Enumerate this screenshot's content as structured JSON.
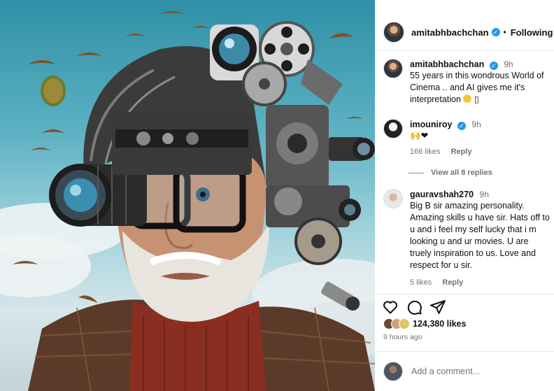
{
  "post": {
    "author": "amitabhbachchan",
    "follow_label": "Following",
    "separator": "•"
  },
  "caption": {
    "author": "amitabhbachchan",
    "time": "9h",
    "text": "55 years in this wondrous World of Cinema .. and AI gives me it's interpretation"
  },
  "comments": [
    {
      "author": "imouniroy",
      "time": "9h",
      "text": "🙌❤",
      "likes": "166 likes",
      "reply_label": "Reply"
    },
    {
      "author": "gauravshah270",
      "time": "9h",
      "text": "Big B sir amazing personality. Amazing skills u have sir. Hats off to u and i feel my self lucky that i m looking u and ur movies. U are truely inspiration to us. Love and respect for u sir.",
      "likes": "5 likes",
      "reply_label": "Reply"
    }
  ],
  "view_replies": "View all 8 replies",
  "likes_count": "124,380 likes",
  "posted_ago": "9 hours ago",
  "add_comment_placeholder": "Add a comment...",
  "icons": {
    "like": "heart-icon",
    "comment": "comment-icon",
    "share": "share-icon"
  },
  "colors": {
    "verified": "#1d9bf0",
    "muted_text": "#737373",
    "sky": "#5fb3c5"
  }
}
